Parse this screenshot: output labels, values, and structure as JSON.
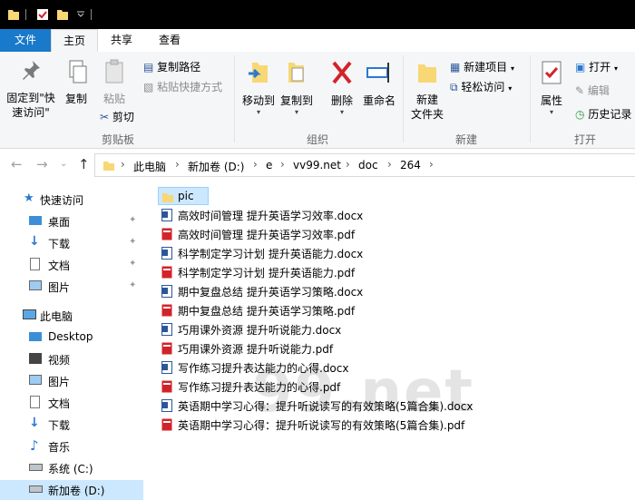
{
  "ribbon_tabs": [
    "文件",
    "主页",
    "共享",
    "查看"
  ],
  "clipboard": {
    "pin_label": "固定到\"快速访问\"",
    "pin_line1": "固定到\"快",
    "pin_line2": "速访问\"",
    "copy": "复制",
    "paste": "粘贴",
    "copy_path": "复制路径",
    "paste_shortcut": "粘贴快捷方式",
    "cut": "剪切",
    "group": "剪贴板"
  },
  "organize": {
    "move_to": "移动到",
    "copy_to": "复制到",
    "delete": "删除",
    "rename": "重命名",
    "group": "组织"
  },
  "new": {
    "new_folder_line1": "新建",
    "new_folder_line2": "文件夹",
    "new_item": "新建项目",
    "easy_access": "轻松访问",
    "group": "新建"
  },
  "open": {
    "properties": "属性",
    "open": "打开",
    "edit": "编辑",
    "history": "历史记录",
    "group": "打开"
  },
  "breadcrumb": [
    "此电脑",
    "新加卷 (D:)",
    "e",
    "vv99.net",
    "doc",
    "264"
  ],
  "nav": {
    "quick_access": "快速访问",
    "quick_items": [
      "桌面",
      "下载",
      "文档",
      "图片"
    ],
    "this_pc": "此电脑",
    "pc_items": [
      "Desktop",
      "视频",
      "图片",
      "文档",
      "下载",
      "音乐",
      "系统 (C:)",
      "新加卷 (D:)"
    ]
  },
  "files": [
    {
      "name": "pic",
      "type": "folder"
    },
    {
      "name": "高效时间管理 提升英语学习效率.docx",
      "type": "docx"
    },
    {
      "name": "高效时间管理 提升英语学习效率.pdf",
      "type": "pdf"
    },
    {
      "name": "科学制定学习计划 提升英语能力.docx",
      "type": "docx"
    },
    {
      "name": "科学制定学习计划 提升英语能力.pdf",
      "type": "pdf"
    },
    {
      "name": "期中复盘总结 提升英语学习策略.docx",
      "type": "docx"
    },
    {
      "name": "期中复盘总结 提升英语学习策略.pdf",
      "type": "pdf"
    },
    {
      "name": "巧用课外资源 提升听说能力.docx",
      "type": "docx"
    },
    {
      "name": "巧用课外资源 提升听说能力.pdf",
      "type": "pdf"
    },
    {
      "name": "写作练习提升表达能力的心得.docx",
      "type": "docx"
    },
    {
      "name": "写作练习提升表达能力的心得.pdf",
      "type": "pdf"
    },
    {
      "name": "英语期中学习心得：提升听说读写的有效策略(5篇合集).docx",
      "type": "docx"
    },
    {
      "name": "英语期中学习心得：提升听说读写的有效策略(5篇合集).pdf",
      "type": "pdf"
    }
  ],
  "watermark": "99.net",
  "colors": {
    "file_tab": "#1979ca",
    "folder": "#f8d775",
    "docx": "#2b579a",
    "pdf": "#d2232a",
    "selected": "#cce8ff"
  }
}
